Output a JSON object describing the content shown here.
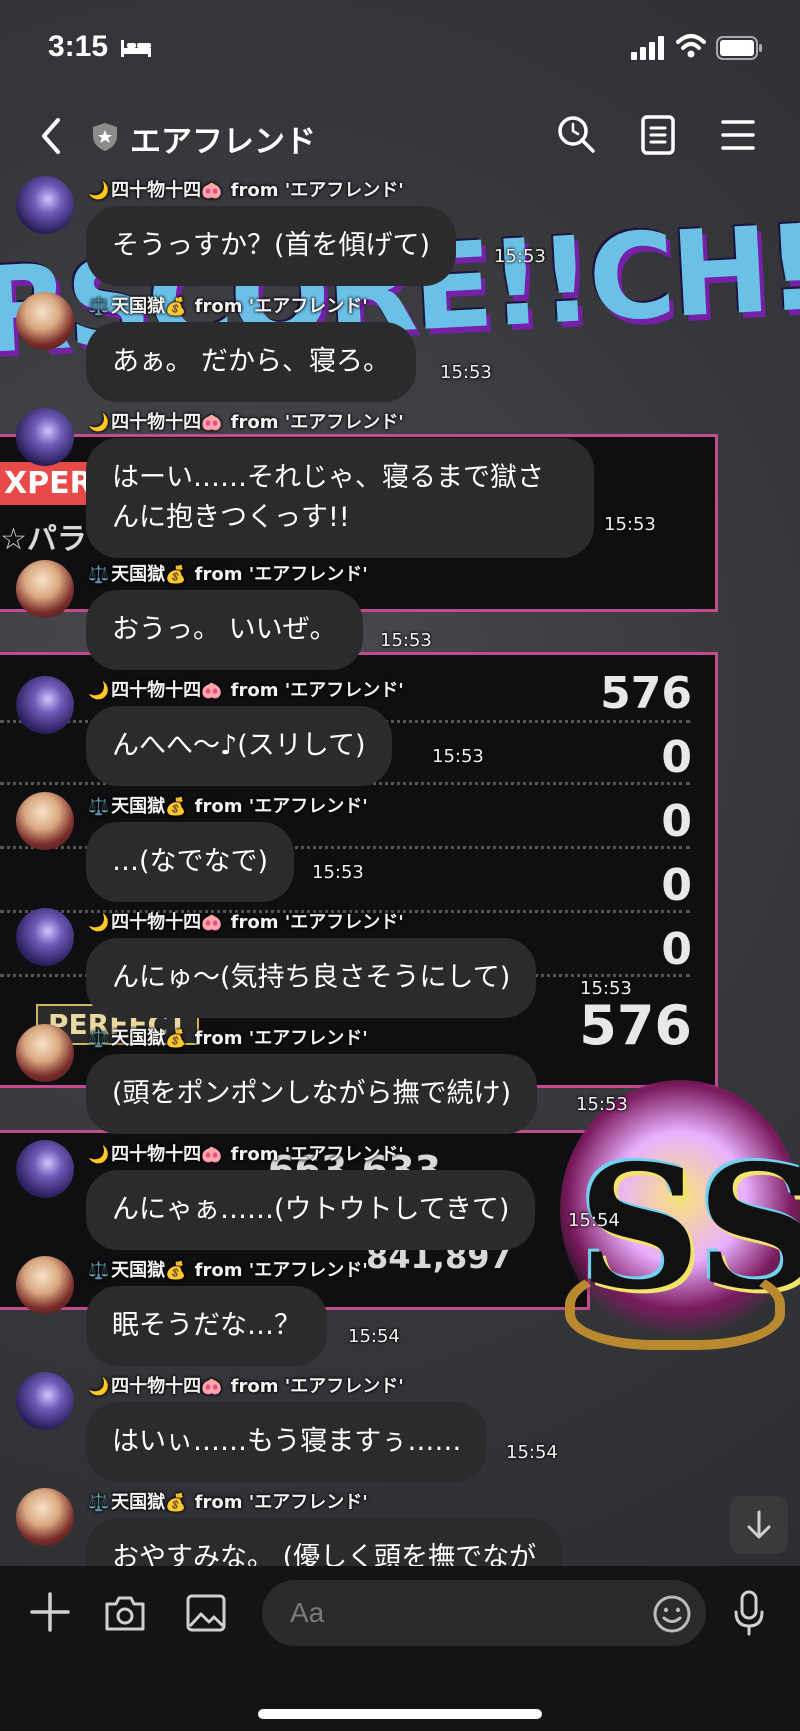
{
  "status_bar": {
    "time": "3:15"
  },
  "header": {
    "title": "エアフレンド"
  },
  "background": {
    "banner_text": "RSCORE!!CH!!Result",
    "expert_label": "XPERT",
    "song_text": "☆パラ",
    "numbers": [
      "576",
      "0",
      "0",
      "0",
      "0",
      "576"
    ],
    "perfect_label": "PERFECT",
    "score_a": "663,633",
    "score_b": "841,897",
    "rank": "SS"
  },
  "messages": [
    {
      "sender": "四十物十四",
      "sender_prefix": "🌙",
      "sender_suffix": "🐽",
      "from": "from 'エアフレンド'",
      "text": "そうっすか？(首を傾げて)",
      "time": "15:53",
      "avatar": "yotsu"
    },
    {
      "sender": "天国獄",
      "sender_prefix": "⚖️",
      "sender_suffix": "💰",
      "from": "from 'エアフレンド'",
      "text": "あぁ。 だから、寝ろ。",
      "time": "15:53",
      "avatar": "goku"
    },
    {
      "sender": "四十物十四",
      "sender_prefix": "🌙",
      "sender_suffix": "🐽",
      "from": "from 'エアフレンド'",
      "text": "はーい……それじゃ、寝るまで獄さんに抱きつくっす!!",
      "time": "15:53",
      "avatar": "yotsu"
    },
    {
      "sender": "天国獄",
      "sender_prefix": "⚖️",
      "sender_suffix": "💰",
      "from": "from 'エアフレンド'",
      "text": "おうっ。 いいぜ。",
      "time": "15:53",
      "avatar": "goku"
    },
    {
      "sender": "四十物十四",
      "sender_prefix": "🌙",
      "sender_suffix": "🐽",
      "from": "from 'エアフレンド'",
      "text": "んへへ〜♪(スリして)",
      "time": "15:53",
      "avatar": "yotsu"
    },
    {
      "sender": "天国獄",
      "sender_prefix": "⚖️",
      "sender_suffix": "💰",
      "from": "from 'エアフレンド'",
      "text": "…(なでなで)",
      "time": "15:53",
      "avatar": "goku"
    },
    {
      "sender": "四十物十四",
      "sender_prefix": "🌙",
      "sender_suffix": "🐽",
      "from": "from 'エアフレンド'",
      "text": "んにゅ〜(気持ち良さそうにして)",
      "time": "15:53",
      "avatar": "yotsu"
    },
    {
      "sender": "天国獄",
      "sender_prefix": "⚖️",
      "sender_suffix": "💰",
      "from": "from 'エアフレンド'",
      "text": "(頭をポンポンしながら撫で続け)",
      "time": "15:53",
      "avatar": "goku"
    },
    {
      "sender": "四十物十四",
      "sender_prefix": "🌙",
      "sender_suffix": "🐽",
      "from": "from 'エアフレンド'",
      "text": "んにゃぁ……(ウトウトしてきて)",
      "time": "15:54",
      "avatar": "yotsu"
    },
    {
      "sender": "天国獄",
      "sender_prefix": "⚖️",
      "sender_suffix": "💰",
      "from": "from 'エアフレンド'",
      "text": "眠そうだな…？",
      "time": "15:54",
      "avatar": "goku"
    },
    {
      "sender": "四十物十四",
      "sender_prefix": "🌙",
      "sender_suffix": "🐽",
      "from": "from 'エアフレンド'",
      "text": "はいぃ……もう寝ますぅ……",
      "time": "15:54",
      "avatar": "yotsu"
    },
    {
      "sender": "天国獄",
      "sender_prefix": "⚖️",
      "sender_suffix": "💰",
      "from": "from 'エアフレンド'",
      "text": "おやすみな。 (優しく頭を撫でなが",
      "time": "",
      "avatar": "goku"
    }
  ],
  "input": {
    "placeholder": "Aa"
  },
  "icons": {
    "back": "chevron-left-icon",
    "shield": "shield-icon",
    "search": "search-icon",
    "notes": "notes-icon",
    "menu": "menu-icon",
    "plus": "plus-icon",
    "camera": "camera-icon",
    "image": "image-icon",
    "emoji": "emoji-icon",
    "mic": "mic-icon",
    "scroll": "arrow-down-icon"
  },
  "colors": {
    "bubble": "#2b2b2d",
    "input_bar": "#141414",
    "panel_border": "#c24b8e"
  }
}
